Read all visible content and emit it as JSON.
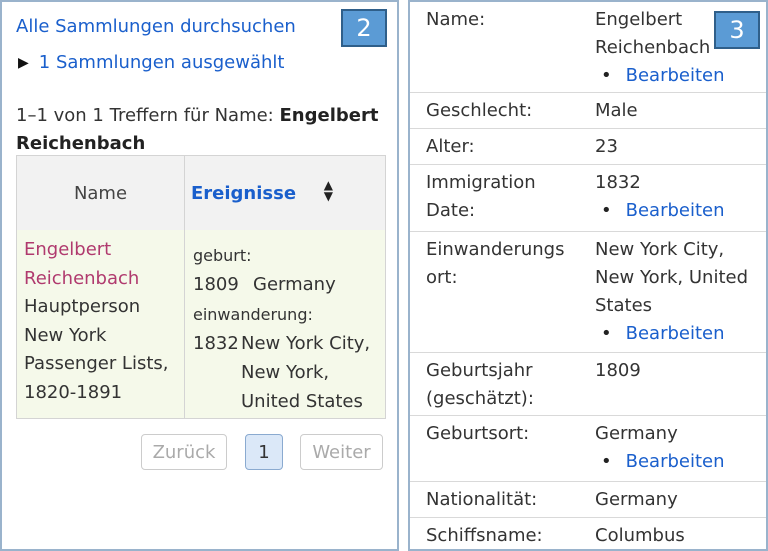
{
  "left": {
    "badge": "2",
    "search_all_link": "Alle Sammlungen durchsuchen",
    "selected_collections": "1 Sammlungen ausgewählt",
    "result_prefix": "1–1 von 1 Treffern für Name: ",
    "result_name": "Engelbert Reichenbach",
    "table": {
      "col_name": "Name",
      "col_events": "Ereignisse",
      "row": {
        "person_line1": "Engelbert",
        "person_line2": "Reichenbach",
        "role": "Hauptperson",
        "collection_line1": "New York",
        "collection_line2": "Passenger Lists,",
        "collection_line3": "1820-1891",
        "birth_label": "geburt:",
        "birth_year": "1809",
        "birth_place": "Germany",
        "immigration_label": "einwanderung:",
        "immigration_year": "1832",
        "immigration_place_line1": "New York City,",
        "immigration_place_line2": "New York,",
        "immigration_place_line3": "United States"
      }
    },
    "pager": {
      "prev": "Zurück",
      "page": "1",
      "next": "Weiter"
    }
  },
  "right": {
    "badge": "3",
    "edit_label": "Bearbeiten",
    "rows": [
      {
        "label": "Name:",
        "value_line1": "Engelbert",
        "value_line2": "Reichenbach"
      },
      {
        "label": "Geschlecht:",
        "value": "Male"
      },
      {
        "label": "Alter:",
        "value": "23"
      },
      {
        "label_line1": "Immigration",
        "label_line2": "Date:",
        "value": "1832"
      },
      {
        "label_line1": "Einwanderungs",
        "label_line2": "ort:",
        "value_line1": "New York City,",
        "value_line2": "New York, United",
        "value_line3": "States"
      },
      {
        "label_line1": "Geburtsjahr",
        "label_line2": "(geschätzt):",
        "value": "1809"
      },
      {
        "label": "Geburtsort:",
        "value": "Germany"
      },
      {
        "label": "Nationalität:",
        "value": "Germany"
      },
      {
        "label": "Schiffsname:",
        "value": "Columbus"
      }
    ]
  }
}
